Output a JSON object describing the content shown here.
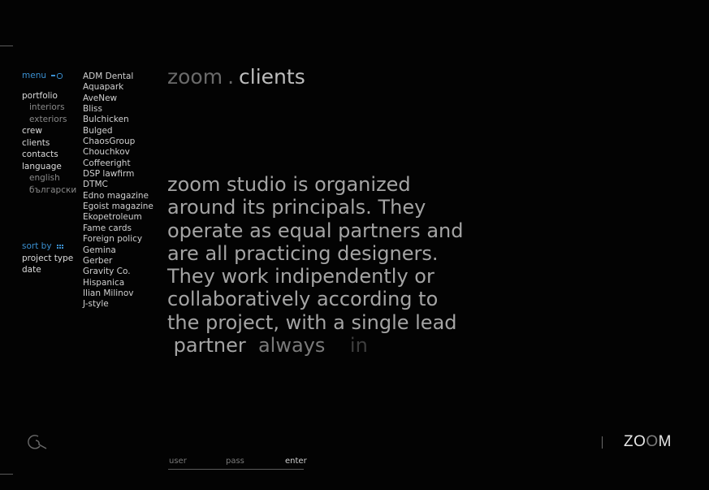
{
  "nav": {
    "menu_label": "menu",
    "items": [
      {
        "label": "portfolio",
        "type": "item"
      },
      {
        "label": "interiors",
        "type": "sub"
      },
      {
        "label": "exteriors",
        "type": "sub"
      },
      {
        "label": "crew",
        "type": "item"
      },
      {
        "label": "clients",
        "type": "item"
      },
      {
        "label": "contacts",
        "type": "item"
      },
      {
        "label": "language",
        "type": "item"
      },
      {
        "label": "english",
        "type": "sub"
      },
      {
        "label": "български",
        "type": "sub"
      }
    ],
    "sort_label": "sort by",
    "sort_items": [
      "project type",
      "date"
    ]
  },
  "clients": [
    "ADM Dental",
    "Aquapark",
    "AveNew",
    "Bliss",
    "Bulchicken",
    "Bulged",
    "ChaosGroup",
    "Chouchkov",
    "Coffeeright",
    "DSP lawfirm",
    "DTMC",
    "Edno magazine",
    "Egoist magazine",
    "Ekopetroleum",
    "Fame cards",
    "Foreign policy",
    "Gemina",
    "Gerber",
    "Gravity Co.",
    "Hispanica",
    "Ilian Milinov",
    "J-style"
  ],
  "title": {
    "site": "zoom",
    "separator": ".",
    "section": "clients"
  },
  "about": {
    "lines": [
      "zoom studio is organized",
      "around its principals. They",
      "operate as equal partners and",
      "are all practicing designers.",
      "They work indipendently or",
      "collaboratively according to",
      "the project, with a single lead"
    ],
    "last_line_words": [
      "partner",
      "always",
      "in"
    ]
  },
  "brand": {
    "letters": [
      "Z",
      "O",
      "O",
      "M"
    ]
  },
  "login": {
    "user_label": "user",
    "pass_label": "pass",
    "enter_label": "enter"
  },
  "colors": {
    "accent": "#3a8fd0",
    "background": "#030303"
  }
}
